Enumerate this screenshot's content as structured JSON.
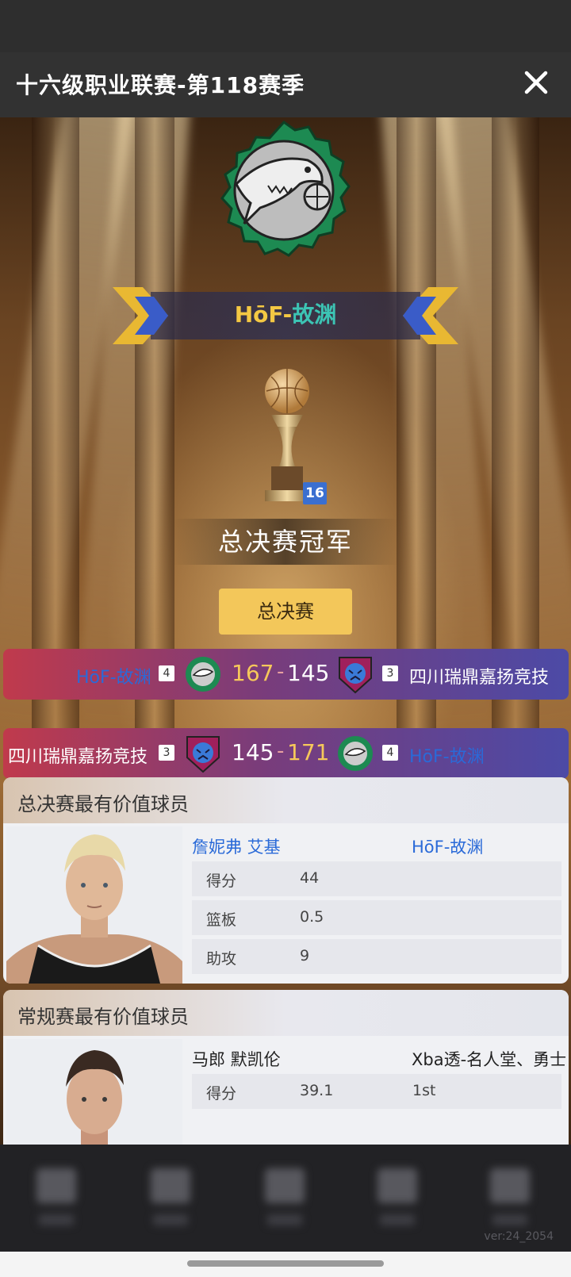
{
  "header": {
    "title": "十六级职业联赛-第118赛季",
    "close_icon": "close-icon"
  },
  "champion": {
    "team_prefix": "HōF-",
    "team_suffix": "故渊",
    "trophy_badge": "16",
    "label": "总决赛冠军",
    "finals_button": "总决赛"
  },
  "games": [
    {
      "left_team": "HōF-故渊",
      "left_seed": "4",
      "left_score": "167",
      "right_score": "145",
      "right_seed": "3",
      "right_team": "四川瑞鼎嘉扬竞技",
      "winner": "left"
    },
    {
      "left_team": "四川瑞鼎嘉扬竞技",
      "left_seed": "3",
      "left_score": "145",
      "right_score": "171",
      "right_seed": "4",
      "right_team": "HōF-故渊",
      "winner": "right"
    }
  ],
  "finals_mvp": {
    "title": "总决赛最有价值球员",
    "player": "詹妮弗 艾基",
    "team": "HōF-故渊",
    "stats": [
      {
        "label": "得分",
        "value": "44"
      },
      {
        "label": "篮板",
        "value": "0.5"
      },
      {
        "label": "助攻",
        "value": "9"
      }
    ]
  },
  "regular_mvp": {
    "title": "常规赛最有价值球员",
    "player": "马郎 默凯伦",
    "team": "Xba透-名人堂、勇士",
    "stats": [
      {
        "label": "得分",
        "value": "39.1",
        "extra": "1st"
      }
    ]
  },
  "footer": {
    "version": "ver:24_2054"
  },
  "colors": {
    "accent_gold": "#f3c75a",
    "team_blue": "#2a6ad8",
    "team_teal": "#3cc4b4"
  }
}
